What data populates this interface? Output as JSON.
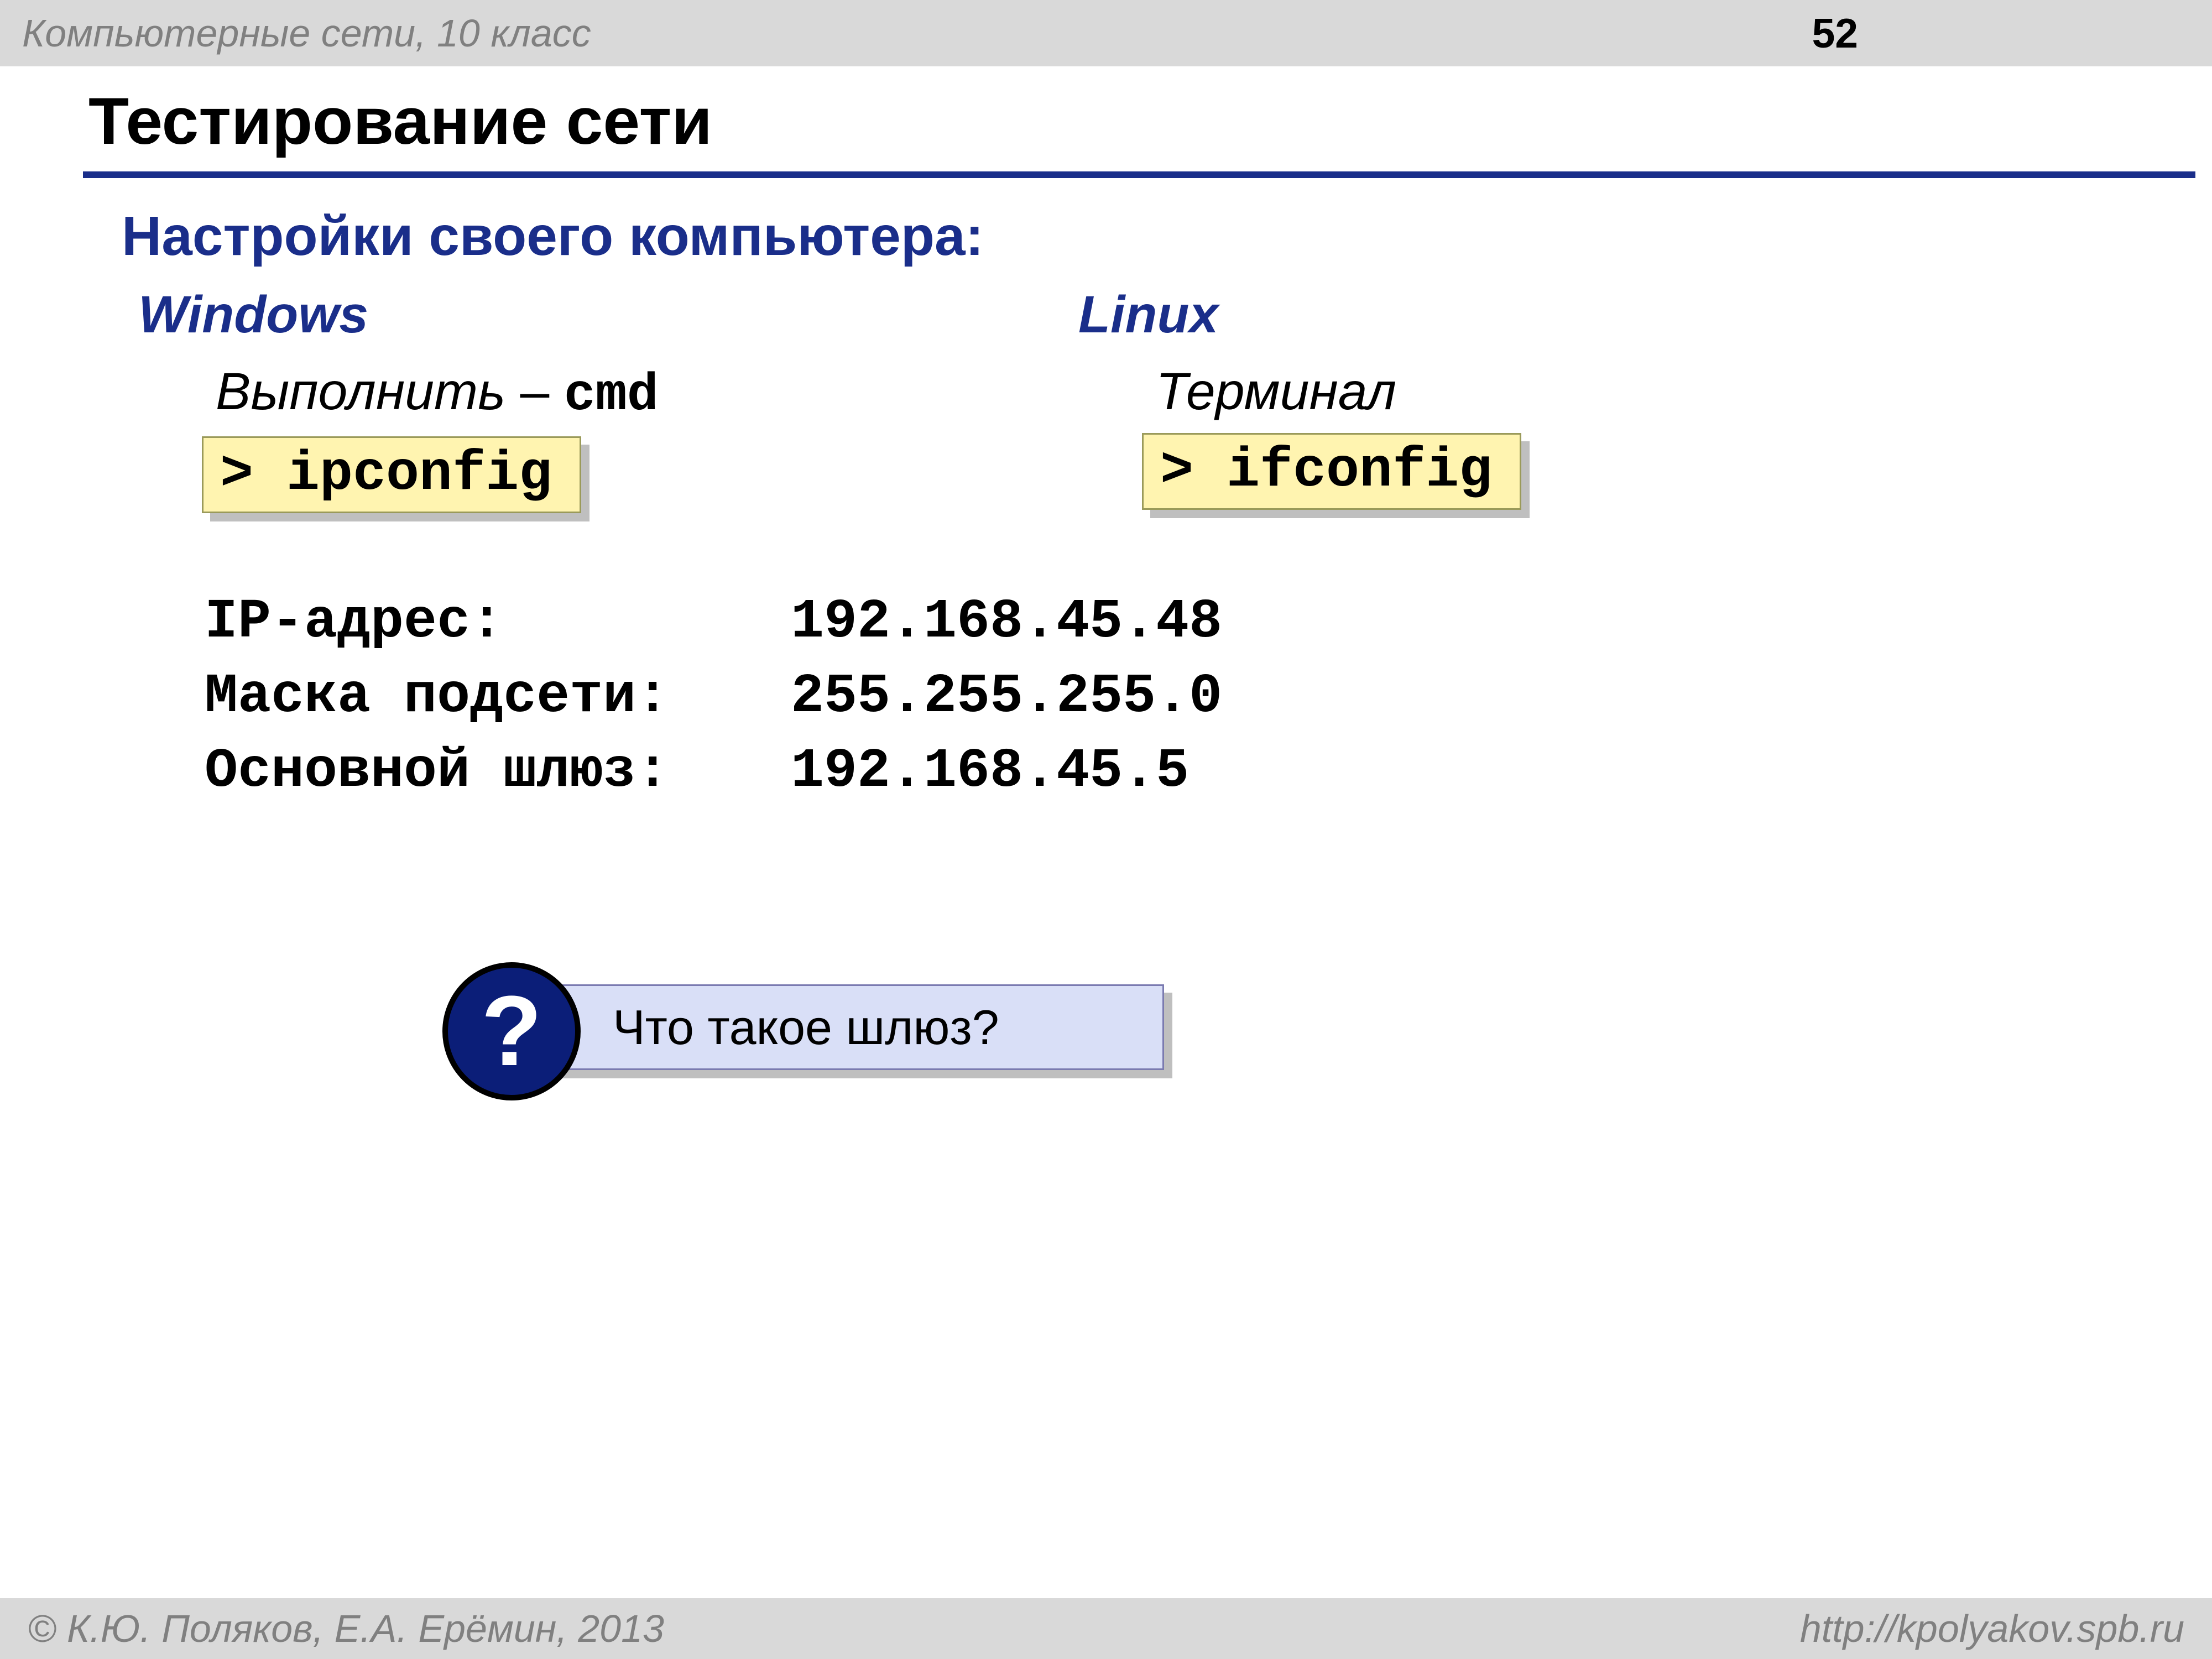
{
  "header": {
    "subject": "Компьютерные сети, 10 класс",
    "page_number": "52"
  },
  "title": "Тестирование сети",
  "section_heading": "Настройки своего компьютера:",
  "windows": {
    "label": "Windows",
    "run_text": "Выполнить",
    "dash": " – ",
    "cmd_word": "cmd",
    "command": "> ipconfig"
  },
  "linux": {
    "label": "Linux",
    "terminal": "Терминал",
    "command": "> ifconfig"
  },
  "network": {
    "rows": [
      {
        "label": "IP-адрес:",
        "value": "192.168.45.48"
      },
      {
        "label": "Маска подсети:",
        "value": "255.255.255.0"
      },
      {
        "label": "Основной шлюз:",
        "value": "192.168.45.5"
      }
    ]
  },
  "question": {
    "mark": "?",
    "text": "Что такое шлюз?"
  },
  "footer": {
    "copyright": "© К.Ю. Поляков, Е.А. Ерёмин, 2013",
    "url": "http://kpolyakov.spb.ru"
  }
}
